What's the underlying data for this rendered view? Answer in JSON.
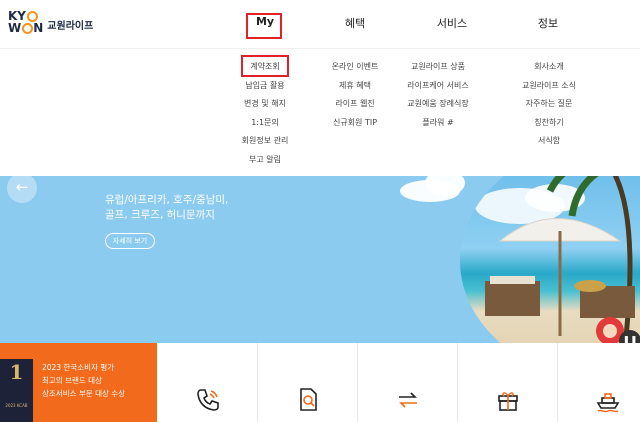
{
  "header": {
    "logo_line1": "KY",
    "logo_line1_end": "",
    "logo_line2": "W",
    "logo_line2_end": "N",
    "logo_text": "교원라이프",
    "nav": [
      "My",
      "혜택",
      "서비스",
      "정보"
    ]
  },
  "dropdown": {
    "my": [
      "계약조회",
      "납입금 활용",
      "변경 및 해지",
      "1:1문의",
      "회원정보 관리",
      "부고 알림"
    ],
    "benefits": [
      "온라인 이벤트",
      "제휴 혜택",
      "라이프 웹진",
      "신규회원 TIP"
    ],
    "services": [
      "교원라이프 상품",
      "라이프케어 서비스",
      "교원예움 장례식장",
      "플라워 #"
    ],
    "info": [
      "회사소개",
      "교원라이프 소식",
      "자주하는 질문",
      "칭찬하기",
      "서식함"
    ]
  },
  "banner": {
    "title_line1": "유럽/아프리카, 호주/중남미,",
    "title_line2": "골프, 크루즈, 허니문까지",
    "button": "자세히 보기",
    "prev_icon": "arrow-left-icon",
    "pause_icon": "pause-icon"
  },
  "award": {
    "badge_number": "1",
    "badge_text": "2023 KCAB",
    "line1": "2023 한국소비자 평가",
    "line2": "최고의 브랜드 대상",
    "line3": "상조서비스 부문 대상 수상"
  },
  "quick_icons": [
    "phone-icon",
    "document-search-icon",
    "transfer-icon",
    "gift-icon",
    "cruise-ship-icon"
  ],
  "colors": {
    "accent_orange": "#f26b1d",
    "highlight_red": "#e0202a",
    "banner_sky": "#8ccbf0",
    "navy": "#1d2238"
  }
}
